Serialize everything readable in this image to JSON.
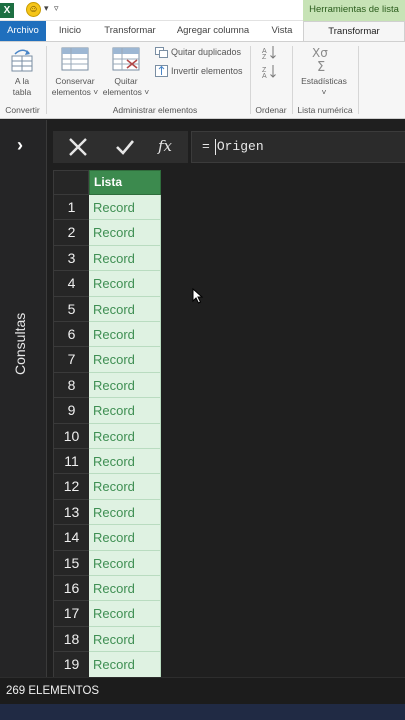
{
  "titlebar": {
    "app_icon": "excel-logo",
    "app_letter": "X",
    "qat_icon": "smiley-icon",
    "contextual_tab": "Herramientas de lista"
  },
  "ribbon_tabs": [
    "Archivo",
    "Inicio",
    "Transformar",
    "Agregar columna",
    "Vista",
    "Transformar"
  ],
  "active_tab": "Transformar",
  "ribbon": {
    "to_table": {
      "line1": "A la",
      "line2": "tabla"
    },
    "keep_items": {
      "line1": "Conservar",
      "line2": "elementos ˅"
    },
    "remove_items": {
      "line1": "Quitar",
      "line2": "elementos ˅"
    },
    "remove_duplicates": "Quitar duplicados",
    "reverse_items": "Invertir elementos",
    "statistics": {
      "line1": "Estadísticas",
      "line2": "˅"
    },
    "groups": {
      "convert": "Convertir",
      "manage": "Administrar elementos",
      "sort": "Ordenar",
      "numeric": "Lista numérica"
    }
  },
  "queries_pane": {
    "label": "Consultas",
    "expand_icon": "chevron-right-icon"
  },
  "formula_bar": {
    "cancel_icon": "close-icon",
    "commit_icon": "checkmark-icon",
    "fx_label": "fx",
    "prefix": "=",
    "formula": "Origen"
  },
  "grid": {
    "column_header": "Lista",
    "rows": [
      {
        "n": "1",
        "v": "Record"
      },
      {
        "n": "2",
        "v": "Record"
      },
      {
        "n": "3",
        "v": "Record"
      },
      {
        "n": "4",
        "v": "Record"
      },
      {
        "n": "5",
        "v": "Record"
      },
      {
        "n": "6",
        "v": "Record"
      },
      {
        "n": "7",
        "v": "Record"
      },
      {
        "n": "8",
        "v": "Record"
      },
      {
        "n": "9",
        "v": "Record"
      },
      {
        "n": "10",
        "v": "Record"
      },
      {
        "n": "11",
        "v": "Record"
      },
      {
        "n": "12",
        "v": "Record"
      },
      {
        "n": "13",
        "v": "Record"
      },
      {
        "n": "14",
        "v": "Record"
      },
      {
        "n": "15",
        "v": "Record"
      },
      {
        "n": "16",
        "v": "Record"
      },
      {
        "n": "17",
        "v": "Record"
      },
      {
        "n": "18",
        "v": "Record"
      },
      {
        "n": "19",
        "v": "Record"
      }
    ]
  },
  "status": {
    "count_text": "269 ELEMENTOS"
  },
  "colors": {
    "header_green": "#3c8a4e",
    "cell_green_bg": "#dff2e2",
    "cell_green_text": "#3f8f53",
    "file_tab_blue": "#1f6fbd",
    "context_tab_green": "#c7e3b6"
  }
}
